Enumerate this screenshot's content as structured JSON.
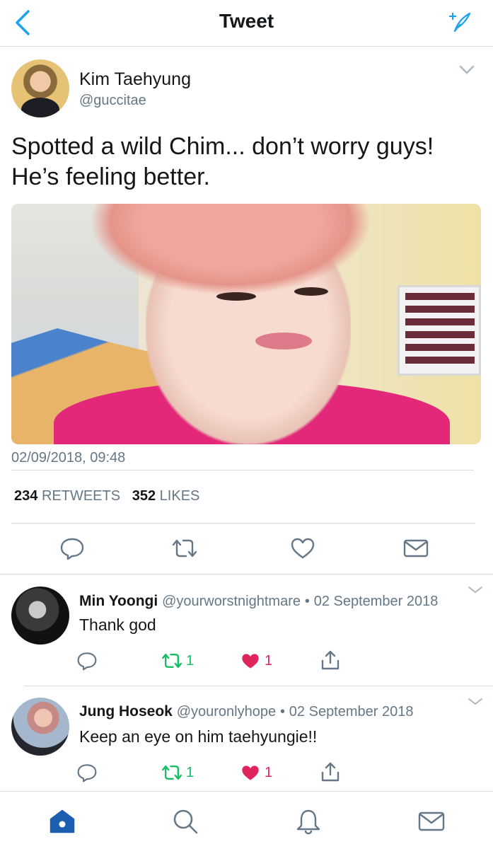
{
  "header": {
    "title": "Tweet"
  },
  "tweet": {
    "author_name": "Kim Taehyung",
    "author_handle": "@guccitae",
    "text_line1": "Spotted a wild Chim... don’t worry guys!",
    "text_line2": "He’s feeling better.",
    "timestamp": "02/09/2018, 09:48",
    "retweet_count": "234",
    "retweet_label": "RETWEETS",
    "like_count": "352",
    "like_label": "LIKES"
  },
  "replies": [
    {
      "name": "Min Yoongi",
      "handle": "@yourworstnightmare",
      "separator": "•",
      "date": "02 September 2018",
      "text": "Thank god",
      "retweets": "1",
      "likes": "1"
    },
    {
      "name": "Jung Hoseok",
      "handle": "@youronlyhope",
      "separator": "•",
      "date": "02 September 2018",
      "text": "Keep an eye on him taehyungie!!",
      "retweets": "1",
      "likes": "1"
    }
  ],
  "colors": {
    "accent": "#1da1f2",
    "retweet_green": "#17bf63",
    "like_red": "#e0245e",
    "secondary_text": "#657786",
    "nav_active": "#1c5fb0"
  },
  "icons": {
    "back": "chevron-left-icon",
    "compose": "compose-sparkle-icon",
    "caret": "chevron-down-icon",
    "reply": "reply-bubble-icon",
    "retweet": "retweet-icon",
    "like": "heart-icon",
    "message": "envelope-icon",
    "share": "share-icon",
    "home": "home-icon",
    "search": "search-icon",
    "notifications": "bell-icon"
  }
}
